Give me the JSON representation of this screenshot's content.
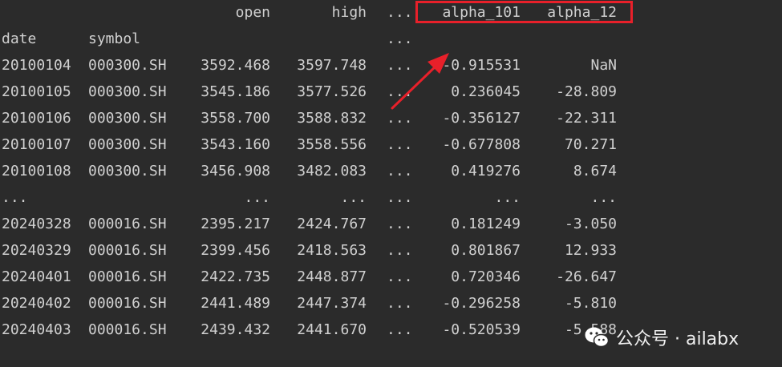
{
  "table": {
    "header_row_1": {
      "open": "open",
      "high": "high",
      "ellipsis": "...",
      "alpha_101": "alpha_101",
      "alpha_12": "alpha_12"
    },
    "header_row_2": {
      "date": "date",
      "symbol": "symbol",
      "ellipsis": "..."
    },
    "rows": [
      {
        "date": "20100104",
        "symbol": "000300.SH",
        "open": "3592.468",
        "high": "3597.748",
        "ellipsis": "...",
        "alpha_101": "-0.915531",
        "alpha_12": "NaN"
      },
      {
        "date": "20100105",
        "symbol": "000300.SH",
        "open": "3545.186",
        "high": "3577.526",
        "ellipsis": "...",
        "alpha_101": "0.236045",
        "alpha_12": "-28.809"
      },
      {
        "date": "20100106",
        "symbol": "000300.SH",
        "open": "3558.700",
        "high": "3588.832",
        "ellipsis": "...",
        "alpha_101": "-0.356127",
        "alpha_12": "-22.311"
      },
      {
        "date": "20100107",
        "symbol": "000300.SH",
        "open": "3543.160",
        "high": "3558.556",
        "ellipsis": "...",
        "alpha_101": "-0.677808",
        "alpha_12": "70.271"
      },
      {
        "date": "20100108",
        "symbol": "000300.SH",
        "open": "3456.908",
        "high": "3482.083",
        "ellipsis": "...",
        "alpha_101": "0.419276",
        "alpha_12": "8.674"
      },
      {
        "date": "...",
        "symbol": "",
        "open": "...",
        "high": "...",
        "ellipsis": "...",
        "alpha_101": "...",
        "alpha_12": "..."
      },
      {
        "date": "20240328",
        "symbol": "000016.SH",
        "open": "2395.217",
        "high": "2424.767",
        "ellipsis": "...",
        "alpha_101": "0.181249",
        "alpha_12": "-3.050"
      },
      {
        "date": "20240329",
        "symbol": "000016.SH",
        "open": "2399.456",
        "high": "2418.563",
        "ellipsis": "...",
        "alpha_101": "0.801867",
        "alpha_12": "12.933"
      },
      {
        "date": "20240401",
        "symbol": "000016.SH",
        "open": "2422.735",
        "high": "2448.877",
        "ellipsis": "...",
        "alpha_101": "0.720346",
        "alpha_12": "-26.647"
      },
      {
        "date": "20240402",
        "symbol": "000016.SH",
        "open": "2441.489",
        "high": "2447.374",
        "ellipsis": "...",
        "alpha_101": "-0.296258",
        "alpha_12": "-5.810"
      },
      {
        "date": "20240403",
        "symbol": "000016.SH",
        "open": "2439.432",
        "high": "2441.670",
        "ellipsis": "...",
        "alpha_101": "-0.520539",
        "alpha_12": "-5.588"
      }
    ]
  },
  "annotation": {
    "box_color": "#e8202a",
    "arrow_color": "#e8202a"
  },
  "watermark": {
    "text": "公众号 · ailabx",
    "icon": "wechat-icon"
  }
}
